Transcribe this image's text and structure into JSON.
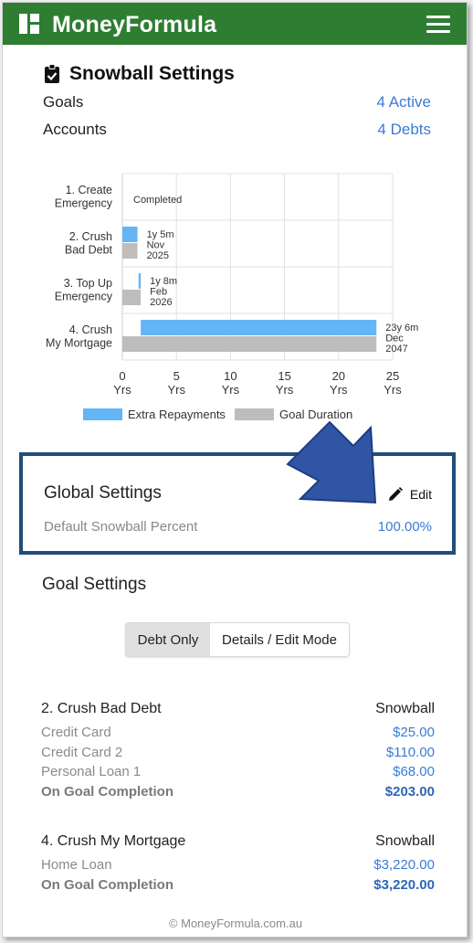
{
  "header": {
    "brand": "MoneyFormula"
  },
  "snowball": {
    "title": "Snowball Settings",
    "goals_label": "Goals",
    "goals_value": "4 Active",
    "accounts_label": "Accounts",
    "accounts_value": "4 Debts"
  },
  "chart_data": {
    "type": "bar",
    "orientation": "horizontal",
    "categories": [
      [
        "1. Create",
        "Emergency"
      ],
      [
        "2. Crush",
        "Bad Debt"
      ],
      [
        "3. Top Up",
        "Emergency"
      ],
      [
        "4. Crush",
        "My Mortgage"
      ]
    ],
    "series": [
      {
        "name": "Extra Repayments",
        "color": "#64b5f6",
        "ranges": [
          null,
          [
            0,
            1.4
          ],
          [
            1.5,
            1.7
          ],
          [
            1.7,
            23.5
          ]
        ]
      },
      {
        "name": "Goal Duration",
        "color": "#bdbdbd",
        "ranges": [
          null,
          [
            0,
            1.4
          ],
          [
            0,
            1.7
          ],
          [
            0,
            23.5
          ]
        ]
      }
    ],
    "annotations": [
      [
        "Completed"
      ],
      [
        "1y 5m",
        "Nov",
        "2025"
      ],
      [
        "1y 8m",
        "Feb",
        "2026"
      ],
      [
        "23y 6m",
        "Dec",
        "2047"
      ]
    ],
    "x_ticks": [
      0,
      5,
      10,
      15,
      20,
      25
    ],
    "x_tick_unit": "Yrs",
    "xlim": [
      0,
      25
    ],
    "grid": true,
    "legend_position": "bottom"
  },
  "global": {
    "title": "Global Settings",
    "edit_label": "Edit",
    "default_label": "Default Snowball Percent",
    "default_value": "100.00%"
  },
  "goal_settings": {
    "title": "Goal Settings",
    "tab_debt_only": "Debt Only",
    "tab_details": "Details / Edit Mode",
    "blocks": [
      {
        "name": "2. Crush Bad Debt",
        "mode": "Snowball",
        "rows": [
          {
            "label": "Credit Card",
            "value": "$25.00"
          },
          {
            "label": "Credit Card 2",
            "value": "$110.00"
          },
          {
            "label": "Personal Loan 1",
            "value": "$68.00"
          }
        ],
        "total_label": "On Goal Completion",
        "total_value": "$203.00"
      },
      {
        "name": "4. Crush My Mortgage",
        "mode": "Snowball",
        "rows": [
          {
            "label": "Home Loan",
            "value": "$3,220.00"
          }
        ],
        "total_label": "On Goal Completion",
        "total_value": "$3,220.00"
      }
    ]
  },
  "footer": {
    "text": "© MoneyFormula.com.au"
  }
}
